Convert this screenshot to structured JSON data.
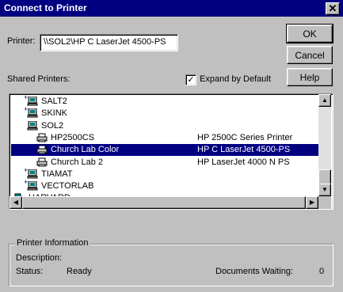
{
  "window": {
    "title": "Connect to Printer",
    "close_symbol": "✕"
  },
  "printer_field": {
    "label": "Printer:",
    "value": "\\\\SOL2\\HP C LaserJet 4500-PS"
  },
  "buttons": {
    "ok": "OK",
    "cancel": "Cancel",
    "help": "Help"
  },
  "shared_printers_label": "Shared Printers:",
  "expand_by_default": {
    "label": "Expand by Default",
    "checked": true
  },
  "tree": [
    {
      "name": "SALT2",
      "type": "computer",
      "expander": "+"
    },
    {
      "name": "SKINK",
      "type": "computer",
      "expander": "+"
    },
    {
      "name": "SOL2",
      "type": "computer",
      "expander": ""
    },
    {
      "name": "HP2500CS",
      "type": "printer",
      "description": "HP 2500C Series Printer"
    },
    {
      "name": "Church Lab Color",
      "type": "printer",
      "description": "HP C LaserJet 4500-PS",
      "selected": true
    },
    {
      "name": "Church Lab 2",
      "type": "printer",
      "description": "HP LaserJet 4000 N PS"
    },
    {
      "name": "TIAMAT",
      "type": "computer",
      "expander": "+"
    },
    {
      "name": "VECTORLAB",
      "type": "computer",
      "expander": "+"
    },
    {
      "name": "HARVARD",
      "type": "network",
      "expander": ""
    }
  ],
  "printer_info": {
    "title": "Printer Information",
    "description_label": "Description:",
    "description_value": "",
    "status_label": "Status:",
    "status_value": "Ready",
    "documents_waiting_label": "Documents Waiting:",
    "documents_waiting_value": "0"
  },
  "colors": {
    "title_bar": "#000080",
    "face": "#c0c0c0",
    "selection": "#000080",
    "computer_icon": "#008080"
  }
}
